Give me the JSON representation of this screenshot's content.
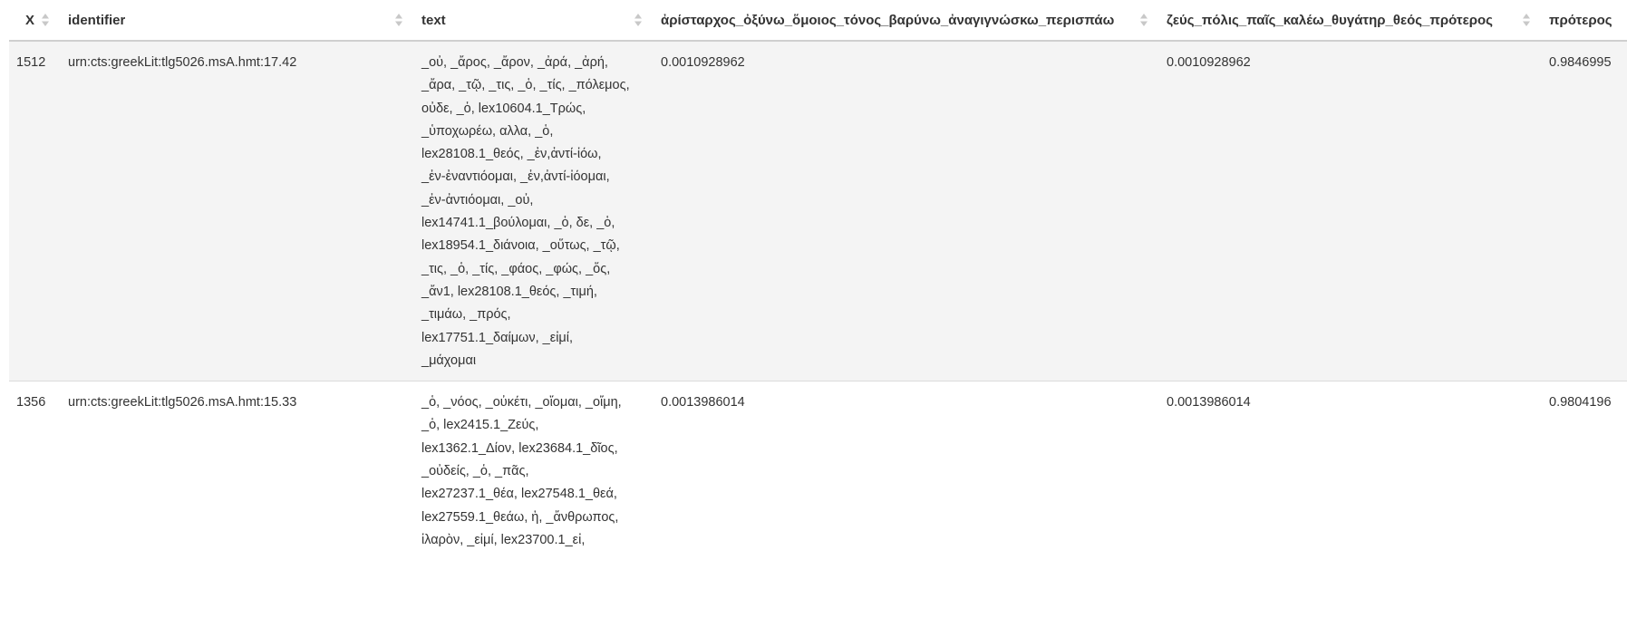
{
  "table": {
    "columns": [
      {
        "key": "x",
        "label": "X"
      },
      {
        "key": "identifier",
        "label": "identifier"
      },
      {
        "key": "text",
        "label": "text"
      },
      {
        "key": "a",
        "label": "ἀρίσταρχος_ὀξύνω_ὅμοιος_τόνος_βαρύνω_ἀναγιγνώσκω_περισπάω"
      },
      {
        "key": "b",
        "label": "ζεύς_πόλις_παῖς_καλέω_θυγάτηρ_θεός_πρότερος"
      },
      {
        "key": "c",
        "label": "πρότερος"
      }
    ],
    "rows": [
      {
        "x": "1512",
        "identifier": "urn:cts:greekLit:tlg5026.msA.hmt:17.42",
        "text_lines": [
          "_οὐ, _ἄρος, _ἄρον, _ἀρά, _ἀρή,",
          "_ἄρα, _τῷ, _τις, _ὁ, _τίς, _πόλεμος,",
          "οὐδε, _ὁ, lex10604.1_Τρώς,",
          "_ὑποχωρέω, αλλα, _ὁ,",
          "lex28108.1_θεός, _ἐν,ἀντί-ἰόω,",
          "_ἐν-ἐναντιόομαι, _ἐν,ἀντί-ἰόομαι,",
          "_ἐν-ἀντιόομαι, _οὐ,",
          "lex14741.1_βούλομαι, _ὁ, δε, _ὁ,",
          "lex18954.1_διάνοια, _οὕτως, _τῷ,",
          "_τις, _ὁ, _τίς, _φάος, _φώς, _ὅς,",
          "_ἄν1, lex28108.1_θεός, _τιμή,",
          "_τιμάω, _πρός,",
          "lex17751.1_δαίμων, _εἰμί,",
          "_μάχομαι"
        ],
        "a": "0.0010928962",
        "b": "0.0010928962",
        "c": "0.9846995"
      },
      {
        "x": "1356",
        "identifier": "urn:cts:greekLit:tlg5026.msA.hmt:15.33",
        "text_lines": [
          "_ὁ, _νόος, _οὐκέτι, _οἴομαι, _οἴμη,",
          "_ὁ, lex2415.1_Ζεύς,",
          "lex1362.1_Δίον, lex23684.1_δῖος,",
          "_οὐδείς, _ὁ, _πᾶς,",
          "lex27237.1_θέα, lex27548.1_θεά,",
          "lex27559.1_θεάω, ἡ, _ἄνθρωπος,",
          "ἱλαρὸν, _εἰμί, lex23700.1_εἰ,"
        ],
        "a": "0.0013986014",
        "b": "0.0013986014",
        "c": "0.9804196"
      }
    ]
  },
  "icons": {
    "sort": "sort-updown-icon"
  },
  "colors": {
    "row_alt": "#f4f4f4",
    "border": "#dcdcdc",
    "header_border": "#cfcfcf",
    "text": "#333333",
    "sort_arrow": "#c8c8c8"
  }
}
